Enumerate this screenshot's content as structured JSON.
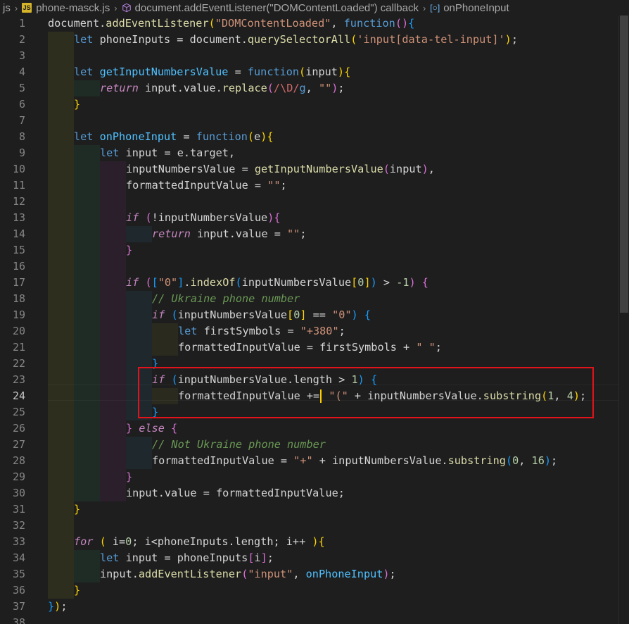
{
  "breadcrumb": {
    "folder": "js",
    "file": "phone-masck.js",
    "callback": "document.addEventListener(\"DOMContentLoaded\") callback",
    "symbol": "onPhoneInput"
  },
  "editor": {
    "active_line": 24,
    "line_numbers": [
      "1",
      "2",
      "3",
      "4",
      "5",
      "6",
      "7",
      "8",
      "9",
      "10",
      "11",
      "12",
      "13",
      "14",
      "15",
      "16",
      "17",
      "18",
      "19",
      "20",
      "21",
      "22",
      "23",
      "24",
      "25",
      "26",
      "27",
      "28",
      "29",
      "30",
      "31",
      "32",
      "33",
      "34",
      "35",
      "36",
      "37",
      "38"
    ]
  },
  "colors": {
    "background": "#1e1e1e",
    "keyword": "#569cd6",
    "control": "#c586c0",
    "function": "#dcdcaa",
    "string": "#ce9178",
    "number": "#b5cea8",
    "comment": "#6a9955",
    "highlight_box": "#e3121b"
  },
  "code": [
    {
      "line": 1,
      "indent": 0,
      "tokens": [
        [
          "p",
          "document."
        ],
        [
          "f",
          "addEventListener"
        ],
        [
          "b1",
          "("
        ],
        [
          "s",
          "\"DOMContentLoaded\""
        ],
        [
          "p",
          ", "
        ],
        [
          "k",
          "function"
        ],
        [
          "b2",
          "()"
        ],
        [
          "b3",
          "{"
        ]
      ]
    },
    {
      "line": 2,
      "indent": 1,
      "tokens": [
        [
          "k",
          "let "
        ],
        [
          "p",
          "phoneInputs = document."
        ],
        [
          "f",
          "querySelectorAll"
        ],
        [
          "b1",
          "("
        ],
        [
          "s",
          "'input[data-tel-input]'"
        ],
        [
          "b1",
          ")"
        ],
        [
          "p",
          ";"
        ]
      ]
    },
    {
      "line": 3,
      "indent": 1,
      "tokens": []
    },
    {
      "line": 4,
      "indent": 1,
      "tokens": [
        [
          "k",
          "let "
        ],
        [
          "fn",
          "getInputNumbersValue"
        ],
        [
          "p",
          " = "
        ],
        [
          "k",
          "function"
        ],
        [
          "b1",
          "("
        ],
        [
          "p",
          "input"
        ],
        [
          "b1",
          ")"
        ],
        [
          "b1",
          "{"
        ]
      ]
    },
    {
      "line": 5,
      "indent": 2,
      "tokens": [
        [
          "kc",
          "return "
        ],
        [
          "p",
          "input.value."
        ],
        [
          "f",
          "replace"
        ],
        [
          "b2",
          "("
        ],
        [
          "rx",
          "/\\D/"
        ],
        [
          "k",
          "g"
        ],
        [
          "p",
          ", "
        ],
        [
          "s",
          "\"\""
        ],
        [
          "b2",
          ")"
        ],
        [
          "p",
          ";"
        ]
      ]
    },
    {
      "line": 6,
      "indent": 1,
      "tokens": [
        [
          "b1",
          "}"
        ]
      ]
    },
    {
      "line": 7,
      "indent": 1,
      "tokens": []
    },
    {
      "line": 8,
      "indent": 1,
      "tokens": [
        [
          "k",
          "let "
        ],
        [
          "fn",
          "onPhoneInput"
        ],
        [
          "p",
          " = "
        ],
        [
          "k",
          "function"
        ],
        [
          "b1",
          "("
        ],
        [
          "p",
          "e"
        ],
        [
          "b1",
          ")"
        ],
        [
          "b1",
          "{"
        ]
      ]
    },
    {
      "line": 9,
      "indent": 2,
      "tokens": [
        [
          "k",
          "let "
        ],
        [
          "p",
          "input = e.target,"
        ]
      ]
    },
    {
      "line": 10,
      "indent": 3,
      "tokens": [
        [
          "p",
          "inputNumbersValue = "
        ],
        [
          "f",
          "getInputNumbersValue"
        ],
        [
          "b2",
          "("
        ],
        [
          "p",
          "input"
        ],
        [
          "b2",
          ")"
        ],
        [
          "p",
          ","
        ]
      ]
    },
    {
      "line": 11,
      "indent": 3,
      "tokens": [
        [
          "p",
          "formattedInputValue = "
        ],
        [
          "s",
          "\"\""
        ],
        [
          "p",
          ";"
        ]
      ]
    },
    {
      "line": 12,
      "indent": 3,
      "tokens": []
    },
    {
      "line": 13,
      "indent": 3,
      "tokens": [
        [
          "kc",
          "if "
        ],
        [
          "b2",
          "("
        ],
        [
          "p",
          "!inputNumbersValue"
        ],
        [
          "b2",
          ")"
        ],
        [
          "b2",
          "{"
        ]
      ]
    },
    {
      "line": 14,
      "indent": 4,
      "tokens": [
        [
          "kc",
          "return "
        ],
        [
          "p",
          "input.value = "
        ],
        [
          "s",
          "\"\""
        ],
        [
          "p",
          ";"
        ]
      ]
    },
    {
      "line": 15,
      "indent": 3,
      "tokens": [
        [
          "b2",
          "}"
        ]
      ]
    },
    {
      "line": 16,
      "indent": 3,
      "tokens": []
    },
    {
      "line": 17,
      "indent": 3,
      "tokens": [
        [
          "kc",
          "if "
        ],
        [
          "b2",
          "("
        ],
        [
          "b3",
          "["
        ],
        [
          "s",
          "\"0\""
        ],
        [
          "b3",
          "]"
        ],
        [
          "p",
          "."
        ],
        [
          "f",
          "indexOf"
        ],
        [
          "b3",
          "("
        ],
        [
          "p",
          "inputNumbersValue"
        ],
        [
          "b1",
          "["
        ],
        [
          "n",
          "0"
        ],
        [
          "b1",
          "]"
        ],
        [
          "b3",
          ")"
        ],
        [
          "p",
          " > "
        ],
        [
          "n",
          "-1"
        ],
        [
          "b2",
          ")"
        ],
        [
          "p",
          " "
        ],
        [
          "b2",
          "{"
        ]
      ]
    },
    {
      "line": 18,
      "indent": 4,
      "tokens": [
        [
          "c",
          "// Ukraine phone number"
        ]
      ]
    },
    {
      "line": 19,
      "indent": 4,
      "tokens": [
        [
          "kc",
          "if "
        ],
        [
          "b3",
          "("
        ],
        [
          "p",
          "inputNumbersValue"
        ],
        [
          "b1",
          "["
        ],
        [
          "n",
          "0"
        ],
        [
          "b1",
          "]"
        ],
        [
          "p",
          " == "
        ],
        [
          "s",
          "\"0\""
        ],
        [
          "b3",
          ")"
        ],
        [
          "p",
          " "
        ],
        [
          "b3",
          "{"
        ]
      ]
    },
    {
      "line": 20,
      "indent": 5,
      "tokens": [
        [
          "k",
          "let "
        ],
        [
          "p",
          "firstSymbols = "
        ],
        [
          "s",
          "\"+380\""
        ],
        [
          "p",
          ";"
        ]
      ]
    },
    {
      "line": 21,
      "indent": 5,
      "tokens": [
        [
          "p",
          "formattedInputValue = firstSymbols + "
        ],
        [
          "s",
          "\" \""
        ],
        [
          "p",
          ";"
        ]
      ]
    },
    {
      "line": 22,
      "indent": 4,
      "tokens": [
        [
          "b3",
          "}"
        ]
      ]
    },
    {
      "line": 23,
      "indent": 4,
      "tokens": [
        [
          "kc",
          "if "
        ],
        [
          "b3",
          "("
        ],
        [
          "p",
          "inputNumbersValue.length > "
        ],
        [
          "n",
          "1"
        ],
        [
          "b3",
          ")"
        ],
        [
          "p",
          " "
        ],
        [
          "b3",
          "{"
        ]
      ]
    },
    {
      "line": 24,
      "indent": 5,
      "tokens": [
        [
          "p",
          "formattedInputValue +="
        ],
        [
          "caret",
          ""
        ],
        [
          "p",
          " "
        ],
        [
          "s",
          "\"(\""
        ],
        [
          "p",
          " + inputNumbersValue."
        ],
        [
          "f",
          "substring"
        ],
        [
          "b1",
          "("
        ],
        [
          "n",
          "1"
        ],
        [
          "p",
          ", "
        ],
        [
          "n",
          "4"
        ],
        [
          "b1",
          ")"
        ],
        [
          "p",
          ";"
        ]
      ]
    },
    {
      "line": 25,
      "indent": 4,
      "tokens": [
        [
          "b3",
          "}"
        ]
      ]
    },
    {
      "line": 26,
      "indent": 3,
      "tokens": [
        [
          "b2",
          "}"
        ],
        [
          "kc",
          " else "
        ],
        [
          "b2",
          "{"
        ]
      ]
    },
    {
      "line": 27,
      "indent": 4,
      "tokens": [
        [
          "c",
          "// Not Ukraine phone number"
        ]
      ]
    },
    {
      "line": 28,
      "indent": 4,
      "tokens": [
        [
          "p",
          "formattedInputValue = "
        ],
        [
          "s",
          "\"+\""
        ],
        [
          "p",
          " + inputNumbersValue."
        ],
        [
          "f",
          "substring"
        ],
        [
          "b3",
          "("
        ],
        [
          "n",
          "0"
        ],
        [
          "p",
          ", "
        ],
        [
          "n",
          "16"
        ],
        [
          "b3",
          ")"
        ],
        [
          "p",
          ";"
        ]
      ]
    },
    {
      "line": 29,
      "indent": 3,
      "tokens": [
        [
          "b2",
          "}"
        ]
      ]
    },
    {
      "line": 30,
      "indent": 3,
      "tokens": [
        [
          "p",
          "input.value = formattedInputValue;"
        ]
      ]
    },
    {
      "line": 31,
      "indent": 1,
      "tokens": [
        [
          "b1",
          "}"
        ]
      ]
    },
    {
      "line": 32,
      "indent": 1,
      "tokens": []
    },
    {
      "line": 33,
      "indent": 1,
      "tokens": [
        [
          "kc",
          "for "
        ],
        [
          "b1",
          "("
        ],
        [
          "p",
          " i="
        ],
        [
          "n",
          "0"
        ],
        [
          "p",
          "; i<phoneInputs.length; i++ "
        ],
        [
          "b1",
          ")"
        ],
        [
          "b1",
          "{"
        ]
      ]
    },
    {
      "line": 34,
      "indent": 2,
      "tokens": [
        [
          "k",
          "let "
        ],
        [
          "p",
          "input = phoneInputs"
        ],
        [
          "b2",
          "["
        ],
        [
          "p",
          "i"
        ],
        [
          "b2",
          "]"
        ],
        [
          "p",
          ";"
        ]
      ]
    },
    {
      "line": 35,
      "indent": 2,
      "tokens": [
        [
          "p",
          "input."
        ],
        [
          "f",
          "addEventListener"
        ],
        [
          "b2",
          "("
        ],
        [
          "s",
          "\"input\""
        ],
        [
          "p",
          ", "
        ],
        [
          "fn",
          "onPhoneInput"
        ],
        [
          "b2",
          ")"
        ],
        [
          "p",
          ";"
        ]
      ]
    },
    {
      "line": 36,
      "indent": 1,
      "tokens": [
        [
          "b1",
          "}"
        ]
      ]
    },
    {
      "line": 37,
      "indent": 0,
      "tokens": [
        [
          "b3",
          "}"
        ],
        [
          "b1",
          ")"
        ],
        [
          "p",
          ";"
        ]
      ]
    },
    {
      "line": 38,
      "indent": 0,
      "tokens": []
    }
  ]
}
